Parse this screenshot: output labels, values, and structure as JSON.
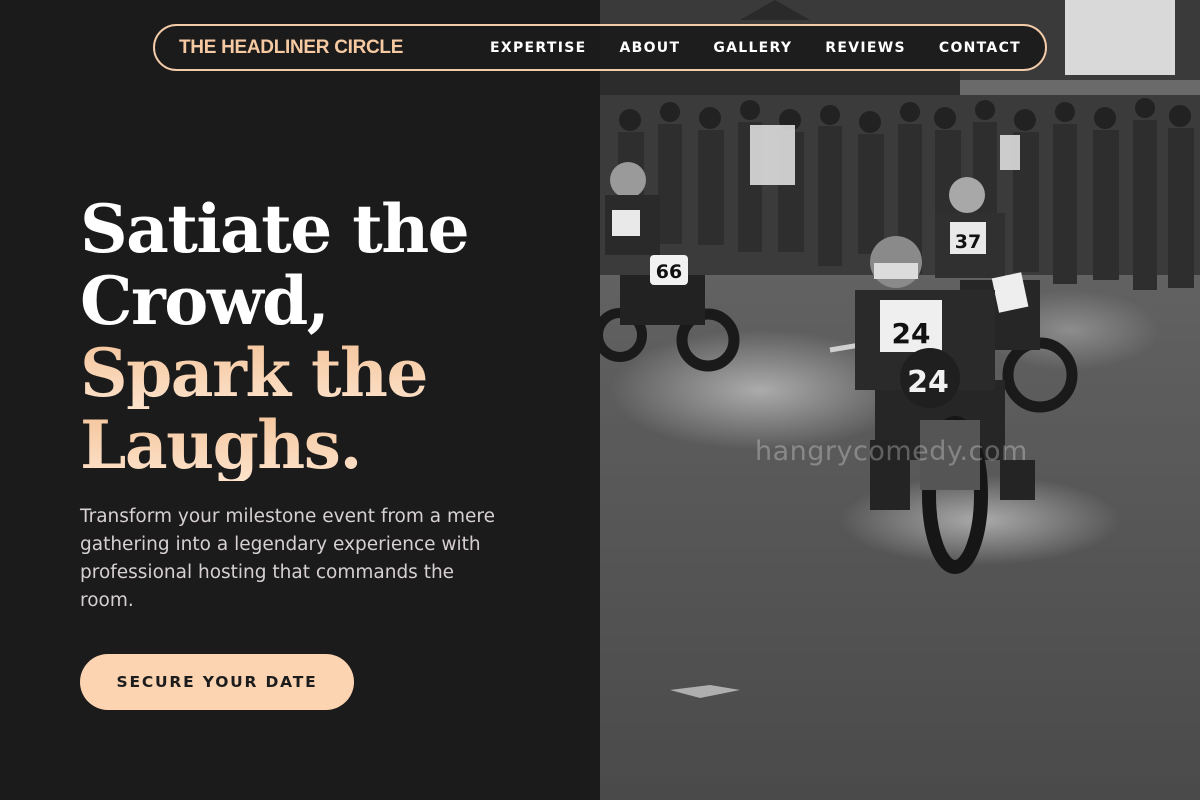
{
  "brand": "THE HEADLINER CIRCLE",
  "nav": [
    {
      "label": "EXPERTISE"
    },
    {
      "label": "ABOUT"
    },
    {
      "label": "GALLERY"
    },
    {
      "label": "REVIEWS"
    },
    {
      "label": "CONTACT"
    }
  ],
  "hero": {
    "line1": "Satiate the",
    "line2": "Crowd,",
    "line3": "Spark the",
    "line4": "Laughs.",
    "body": "Transform your milestone event from a mere gathering into a legendary experience with professional hosting that commands the room.",
    "cta": "SECURE YOUR DATE"
  },
  "photo": {
    "watermark": "hangrycomedy.com",
    "bib_main": "24",
    "bib_left": "66",
    "bib_right": "37"
  },
  "colors": {
    "background": "#1c1b1c",
    "accent": "#f5c9a2",
    "cta": "#fdd4b1",
    "body_text": "#d6d0d2"
  }
}
